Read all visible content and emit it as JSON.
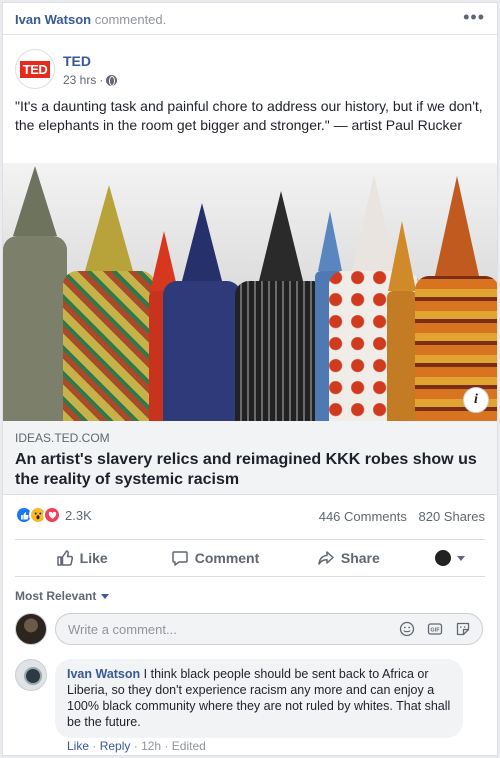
{
  "topbar": {
    "actor": "Ivan Watson",
    "action": "commented.",
    "more": "•••"
  },
  "post": {
    "page_logo": "TED",
    "page_name": "TED",
    "time": "23 hrs",
    "separator": "·",
    "privacy_icon": "globe-icon",
    "text": "\"It's a daunting task and painful chore to address our history, but if we don't, the elephants in the room get bigger and stronger.\" — artist Paul Rucker",
    "image_info_icon": "i",
    "link": {
      "domain": "IDEAS.TED.COM",
      "headline": "An artist's slavery relics and reimagined KKK robes show us the reality of systemic racism"
    }
  },
  "stats": {
    "reaction_icons": [
      "like-reaction-icon",
      "wow-reaction-icon",
      "love-reaction-icon"
    ],
    "reaction_count": "2.3K",
    "comments": "446 Comments",
    "shares": "820 Shares"
  },
  "actions": {
    "like": "Like",
    "comment": "Comment",
    "share": "Share"
  },
  "comments_section": {
    "sort_label": "Most Relevant",
    "input_placeholder": "Write a comment...",
    "input_icons": [
      "emoji-icon",
      "gif-icon",
      "sticker-icon"
    ],
    "comment": {
      "author": "Ivan Watson",
      "text": "I think black people should be sent back to Africa or Liberia, so they don't experience racism any more and can enjoy a 100% black community where they are not ruled by whites. That shall be the future.",
      "like": "Like",
      "dot": "·",
      "reply": "Reply",
      "time": "12h",
      "edited": "Edited"
    }
  },
  "colors": {
    "link": "#385898",
    "ted_red": "#e62b1e",
    "like_blue": "#1877f2",
    "love_red": "#f33e58",
    "wow_yellow": "#f7b928"
  }
}
